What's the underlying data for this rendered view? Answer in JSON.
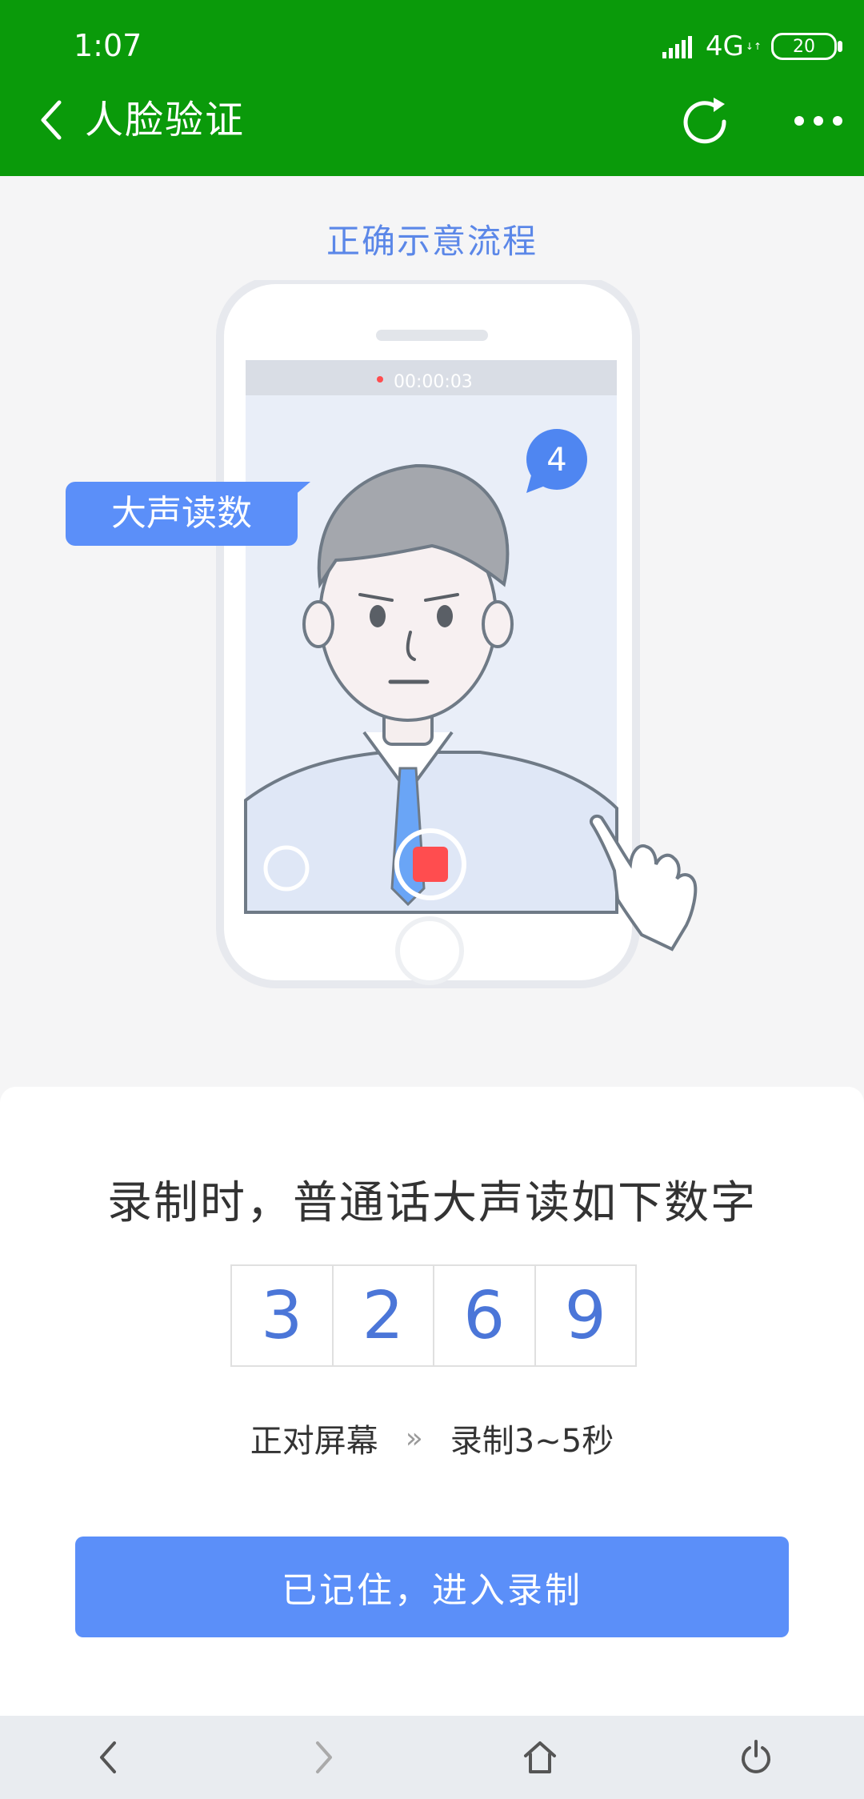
{
  "status_bar": {
    "time": "1:07",
    "network": "4G",
    "network_sub": "↓↑",
    "battery": "20"
  },
  "header": {
    "title": "人脸验证",
    "icons": [
      "back-icon",
      "refresh-icon",
      "more-icon"
    ]
  },
  "illustration": {
    "title": "正确示意流程",
    "timer": "00:00:03",
    "count_badge": "4",
    "callout": "大声读数"
  },
  "panel": {
    "instruction": "录制时，普通话大声读如下数字",
    "digits": [
      "3",
      "2",
      "6",
      "9"
    ],
    "steps": {
      "first": "正对屏幕",
      "separator": "»",
      "second": "录制3~5秒"
    },
    "button_label": "已记住，进入录制"
  },
  "nav": {
    "items": [
      "back-icon",
      "forward-icon",
      "home-icon",
      "power-icon"
    ]
  },
  "colors": {
    "header_green": "#0a9a0a",
    "accent_blue": "#5b8ff9",
    "digit_blue": "#4b76d8",
    "record_red": "#ff4d4f"
  }
}
